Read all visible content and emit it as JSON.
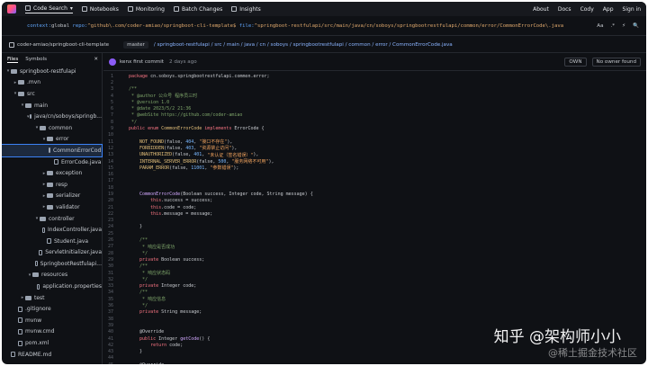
{
  "nav": {
    "items": [
      "Code Search",
      "Notebooks",
      "Monitoring",
      "Batch Changes",
      "Insights"
    ],
    "right": [
      "About",
      "Docs",
      "Cody",
      "App",
      "Sign in"
    ]
  },
  "search": {
    "query_parts": [
      {
        "t": "context:",
        "c": "kw"
      },
      {
        "t": "global ",
        "c": ""
      },
      {
        "t": "repo:",
        "c": "kw"
      },
      {
        "t": "^github\\.com/coder-amiao/springboot-cli-template$ ",
        "c": "str"
      },
      {
        "t": "file:",
        "c": "kw"
      },
      {
        "t": "^springboot-restfulapi/src/main/java/cn/soboys/springbootrestfulapi/common/error/CommonErrorCode\\.java",
        "c": "str"
      }
    ],
    "tools": [
      "Aa",
      ".*",
      "⚡"
    ]
  },
  "repo": {
    "name": "coder-amiao/springboot-cli-template",
    "branch": "master",
    "breadcrumb": "/ springboot-restfulapi / src / main / java / cn / soboys / springbootrestfulapi / common / error / CommonErrorCode.java"
  },
  "sidebar": {
    "tabs": [
      "Files",
      "Symbols"
    ],
    "tree": [
      {
        "label": "springboot-restfulapi",
        "depth": 0,
        "kind": "folder",
        "open": true
      },
      {
        "label": ".mvn",
        "depth": 1,
        "kind": "folder",
        "open": false
      },
      {
        "label": "src",
        "depth": 1,
        "kind": "folder",
        "open": true
      },
      {
        "label": "main",
        "depth": 2,
        "kind": "folder",
        "open": true
      },
      {
        "label": "java/cn/soboys/springb...",
        "depth": 3,
        "kind": "folder",
        "open": true
      },
      {
        "label": "common",
        "depth": 4,
        "kind": "folder",
        "open": true
      },
      {
        "label": "error",
        "depth": 5,
        "kind": "folder",
        "open": true
      },
      {
        "label": "CommonErrorCod...",
        "depth": 6,
        "kind": "file",
        "selected": true
      },
      {
        "label": "ErrorCode.java",
        "depth": 6,
        "kind": "file"
      },
      {
        "label": "exception",
        "depth": 5,
        "kind": "folder",
        "open": false
      },
      {
        "label": "resp",
        "depth": 5,
        "kind": "folder",
        "open": false
      },
      {
        "label": "serializer",
        "depth": 5,
        "kind": "folder",
        "open": false
      },
      {
        "label": "validator",
        "depth": 5,
        "kind": "folder",
        "open": false
      },
      {
        "label": "controller",
        "depth": 4,
        "kind": "folder",
        "open": true
      },
      {
        "label": "IndexController.java",
        "depth": 5,
        "kind": "file"
      },
      {
        "label": "Student.java",
        "depth": 5,
        "kind": "file"
      },
      {
        "label": "ServletInitializer.java",
        "depth": 4,
        "kind": "file"
      },
      {
        "label": "SpringbootRestfulapi...",
        "depth": 4,
        "kind": "file"
      },
      {
        "label": "resources",
        "depth": 3,
        "kind": "folder",
        "open": true
      },
      {
        "label": "application.properties",
        "depth": 4,
        "kind": "file"
      },
      {
        "label": "test",
        "depth": 2,
        "kind": "folder",
        "open": false
      },
      {
        "label": ".gitignore",
        "depth": 1,
        "kind": "file"
      },
      {
        "label": "mvnw",
        "depth": 1,
        "kind": "file"
      },
      {
        "label": "mvnw.cmd",
        "depth": 1,
        "kind": "file"
      },
      {
        "label": "pom.xml",
        "depth": 1,
        "kind": "file"
      },
      {
        "label": "README.md",
        "depth": 0,
        "kind": "file"
      }
    ]
  },
  "commit": {
    "author": "kenx",
    "message": "first commit",
    "time": "2 days ago",
    "own_label": "OWN",
    "owner_label": "No owner found"
  },
  "code": [
    {
      "n": 1,
      "p": [
        [
          "package ",
          "k"
        ],
        [
          "cn.soboys.springbootrestfulapi.common.error;",
          "tx"
        ]
      ]
    },
    {
      "n": 2,
      "p": []
    },
    {
      "n": 3,
      "p": [
        [
          "/**",
          "c"
        ]
      ]
    },
    {
      "n": 4,
      "p": [
        [
          " * @author 公众号 程序员三时",
          "c"
        ]
      ]
    },
    {
      "n": 5,
      "p": [
        [
          " * @version 1.0",
          "c"
        ]
      ]
    },
    {
      "n": 6,
      "p": [
        [
          " * @date 2023/5/2 21:36",
          "c"
        ]
      ]
    },
    {
      "n": 7,
      "p": [
        [
          " * @webSite https://github.com/coder-amiao",
          "c"
        ]
      ]
    },
    {
      "n": 8,
      "p": [
        [
          " */",
          "c"
        ]
      ]
    },
    {
      "n": 9,
      "p": [
        [
          "public enum ",
          "k"
        ],
        [
          "CommonErrorCode ",
          "v"
        ],
        [
          "implements ",
          "k"
        ],
        [
          "ErrorCode {",
          "tx"
        ]
      ]
    },
    {
      "n": 10,
      "p": []
    },
    {
      "n": 11,
      "p": [
        [
          "    NOT_FOUND",
          "v"
        ],
        [
          "(false, ",
          "tx"
        ],
        [
          "404",
          "n"
        ],
        [
          ", ",
          "tx"
        ],
        [
          "\"接口不存在\"",
          "s"
        ],
        [
          "),",
          "tx"
        ]
      ]
    },
    {
      "n": 12,
      "p": [
        [
          "    FORBIDDEN",
          "v"
        ],
        [
          "(false, ",
          "tx"
        ],
        [
          "403",
          "n"
        ],
        [
          ", ",
          "tx"
        ],
        [
          "\"资源禁止访问\"",
          "s"
        ],
        [
          "),",
          "tx"
        ]
      ]
    },
    {
      "n": 13,
      "p": [
        [
          "    UNAUTHORIZED",
          "v"
        ],
        [
          "(false, ",
          "tx"
        ],
        [
          "401",
          "n"
        ],
        [
          ", ",
          "tx"
        ],
        [
          "\"未认证（签名错误）\"",
          "s"
        ],
        [
          "),",
          "tx"
        ]
      ]
    },
    {
      "n": 14,
      "p": [
        [
          "    INTERNAL_SERVER_ERROR",
          "v"
        ],
        [
          "(false, ",
          "tx"
        ],
        [
          "500",
          "n"
        ],
        [
          ", ",
          "tx"
        ],
        [
          "\"服务网络不可用\"",
          "s"
        ],
        [
          "),",
          "tx"
        ]
      ]
    },
    {
      "n": 15,
      "p": [
        [
          "    PARAM_ERROR",
          "v"
        ],
        [
          "(false, ",
          "tx"
        ],
        [
          "11001",
          "n"
        ],
        [
          ", ",
          "tx"
        ],
        [
          "\"参数错误\"",
          "s"
        ],
        [
          ");",
          "tx"
        ]
      ]
    },
    {
      "n": 16,
      "p": []
    },
    {
      "n": 17,
      "p": []
    },
    {
      "n": 18,
      "p": []
    },
    {
      "n": 19,
      "p": [
        [
          "    CommonErrorCode",
          "f"
        ],
        [
          "(Boolean success, Integer code, String message) {",
          "tx"
        ]
      ]
    },
    {
      "n": 20,
      "p": [
        [
          "        this",
          "k"
        ],
        [
          ".success = success;",
          "tx"
        ]
      ]
    },
    {
      "n": 21,
      "p": [
        [
          "        this",
          "k"
        ],
        [
          ".code = code;",
          "tx"
        ]
      ]
    },
    {
      "n": 22,
      "p": [
        [
          "        this",
          "k"
        ],
        [
          ".message = message;",
          "tx"
        ]
      ]
    },
    {
      "n": 23,
      "p": []
    },
    {
      "n": 24,
      "p": [
        [
          "    }",
          "tx"
        ]
      ]
    },
    {
      "n": 25,
      "p": []
    },
    {
      "n": 26,
      "p": [
        [
          "    /**",
          "c"
        ]
      ]
    },
    {
      "n": 27,
      "p": [
        [
          "     * 响应是否成功",
          "c"
        ]
      ]
    },
    {
      "n": 28,
      "p": [
        [
          "     */",
          "c"
        ]
      ]
    },
    {
      "n": 29,
      "p": [
        [
          "    private ",
          "k"
        ],
        [
          "Boolean success;",
          "tx"
        ]
      ]
    },
    {
      "n": 30,
      "p": [
        [
          "    /**",
          "c"
        ]
      ]
    },
    {
      "n": 31,
      "p": [
        [
          "     * 响应状态码",
          "c"
        ]
      ]
    },
    {
      "n": 32,
      "p": [
        [
          "     */",
          "c"
        ]
      ]
    },
    {
      "n": 33,
      "p": [
        [
          "    private ",
          "k"
        ],
        [
          "Integer code;",
          "tx"
        ]
      ]
    },
    {
      "n": 34,
      "p": [
        [
          "    /**",
          "c"
        ]
      ]
    },
    {
      "n": 35,
      "p": [
        [
          "     * 响应信息",
          "c"
        ]
      ]
    },
    {
      "n": 36,
      "p": [
        [
          "     */",
          "c"
        ]
      ]
    },
    {
      "n": 37,
      "p": [
        [
          "    private ",
          "k"
        ],
        [
          "String message;",
          "tx"
        ]
      ]
    },
    {
      "n": 38,
      "p": []
    },
    {
      "n": 39,
      "p": []
    },
    {
      "n": 40,
      "p": [
        [
          "    @Override",
          "tx"
        ]
      ]
    },
    {
      "n": 41,
      "p": [
        [
          "    public ",
          "k"
        ],
        [
          "Integer ",
          "tx"
        ],
        [
          "getCode",
          "f"
        ],
        [
          "() {",
          "tx"
        ]
      ]
    },
    {
      "n": 42,
      "p": [
        [
          "        return ",
          "k"
        ],
        [
          "code;",
          "tx"
        ]
      ]
    },
    {
      "n": 43,
      "p": [
        [
          "    }",
          "tx"
        ]
      ]
    },
    {
      "n": 44,
      "p": []
    },
    {
      "n": 45,
      "p": [
        [
          "    @Override",
          "tx"
        ]
      ]
    },
    {
      "n": 46,
      "p": [
        [
          "    public ",
          "k"
        ],
        [
          "String ",
          "tx"
        ],
        [
          "getMessage",
          "f"
        ],
        [
          "() {",
          "tx"
        ]
      ]
    },
    {
      "n": 47,
      "p": [
        [
          "        return ",
          "k"
        ],
        [
          "message;",
          "tx"
        ]
      ]
    }
  ],
  "watermark": {
    "main": "知乎 @架构师小小",
    "sub": "@稀土掘金技术社区"
  }
}
